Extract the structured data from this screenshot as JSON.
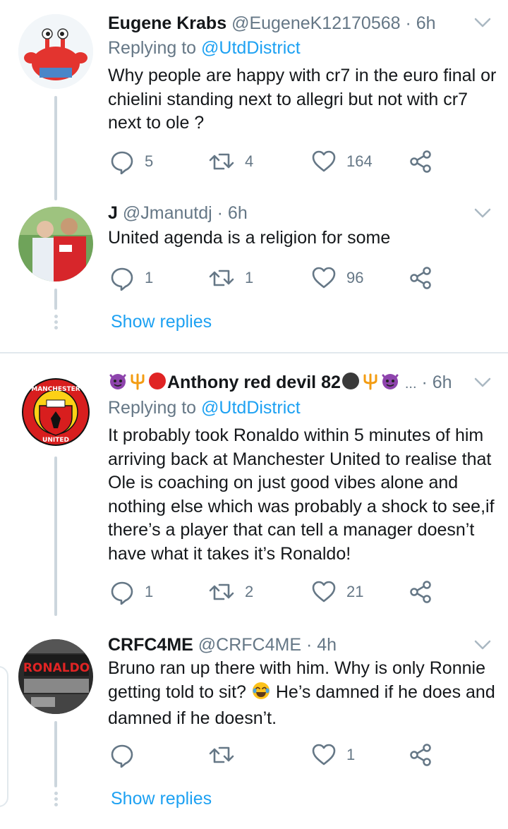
{
  "tweets": [
    {
      "name": "Eugene Krabs",
      "handle": "@EugeneK12170568",
      "time": "6h",
      "reply_prefix": "Replying to",
      "reply_to": "@UtdDistrict",
      "text": "Why people are happy with cr7 in the euro final or chielini standing next to allegri but not with cr7 next to ole ?",
      "replies": "5",
      "retweets": "4",
      "likes": "164"
    },
    {
      "name": "J",
      "handle": "@Jmanutdj",
      "time": "6h",
      "text": "United agenda is a religion for some",
      "replies": "1",
      "retweets": "1",
      "likes": "96",
      "show_replies": "Show replies"
    },
    {
      "name": "Anthony red devil 82",
      "handle": "...",
      "time": "6h",
      "reply_prefix": "Replying to",
      "reply_to": "@UtdDistrict",
      "text": "It probably took Ronaldo within 5 minutes of him arriving back at Manchester United to realise that Ole is coaching on just good vibes alone and nothing else which was probably a shock to see,if there’s a player that can tell a manager doesn’t have what it takes it’s Ronaldo!",
      "replies": "1",
      "retweets": "2",
      "likes": "21",
      "avatar_text_top": "MANCHESTER",
      "avatar_text_bottom": "UNITED"
    },
    {
      "name": "CRFC4ME",
      "handle": "@CRFC4ME",
      "time": "4h",
      "text_before_emoji": "Bruno ran up there with him. Why is only Ronnie getting told to sit?",
      "text_after_emoji": "He’s damned if he does and damned if he doesn’t.",
      "replies": "",
      "retweets": "",
      "likes": "1",
      "show_replies": "Show replies",
      "avatar_text": "RONALDO"
    }
  ],
  "separator": "·",
  "colors": {
    "text": "#14171a",
    "secondary": "#657786",
    "link": "#1da1f2",
    "line": "#ccd6dd",
    "divider": "#e1e8ed"
  },
  "icons": [
    "reply-icon",
    "retweet-icon",
    "like-icon",
    "share-icon",
    "chevron-down-icon"
  ]
}
